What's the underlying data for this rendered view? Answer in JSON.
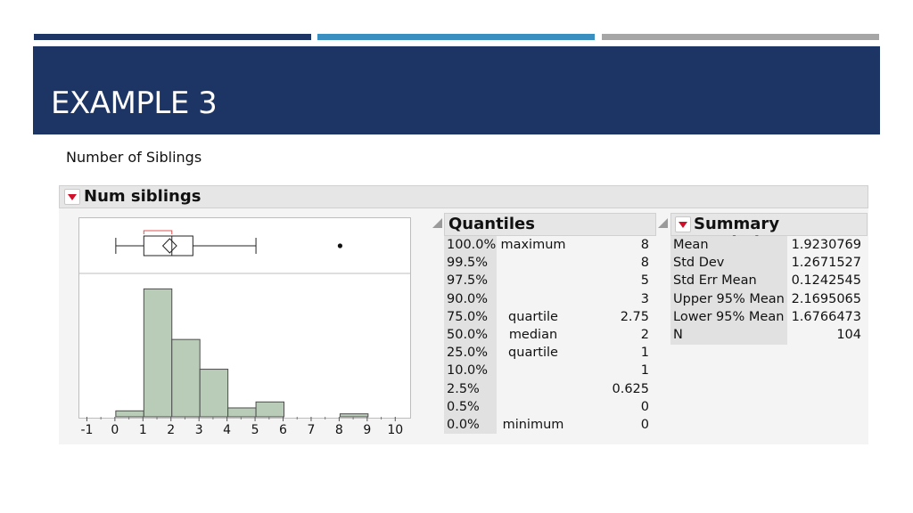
{
  "slide": {
    "title": "EXAMPLE 3",
    "subtitle": "Number of Siblings",
    "bar_colors": [
      "#1c3564",
      "#3a8fc1",
      "#a6a6a6"
    ]
  },
  "report": {
    "title": "Num siblings",
    "quantiles": {
      "title": "Quantiles",
      "rows": [
        {
          "pct": "100.0%",
          "label": "maximum",
          "value": "8"
        },
        {
          "pct": "99.5%",
          "label": "",
          "value": "8"
        },
        {
          "pct": "97.5%",
          "label": "",
          "value": "5"
        },
        {
          "pct": "90.0%",
          "label": "",
          "value": "3"
        },
        {
          "pct": "75.0%",
          "label": "quartile",
          "value": "2.75"
        },
        {
          "pct": "50.0%",
          "label": "median",
          "value": "2"
        },
        {
          "pct": "25.0%",
          "label": "quartile",
          "value": "1"
        },
        {
          "pct": "10.0%",
          "label": "",
          "value": "1"
        },
        {
          "pct": "2.5%",
          "label": "",
          "value": "0.625"
        },
        {
          "pct": "0.5%",
          "label": "",
          "value": "0"
        },
        {
          "pct": "0.0%",
          "label": "minimum",
          "value": "0"
        }
      ]
    },
    "summary": {
      "title": "Summary Statistics",
      "rows": [
        {
          "label": "Mean",
          "value": "1.9230769"
        },
        {
          "label": "Std Dev",
          "value": "1.2671527"
        },
        {
          "label": "Std Err Mean",
          "value": "0.1242545"
        },
        {
          "label": "Upper 95% Mean",
          "value": "2.1695065"
        },
        {
          "label": "Lower 95% Mean",
          "value": "1.6766473"
        },
        {
          "label": "N",
          "value": "104"
        }
      ]
    }
  },
  "chart_data": {
    "type": "bar",
    "title": "",
    "xlabel": "",
    "ylabel": "",
    "bins": [
      [
        0,
        1
      ],
      [
        1,
        2
      ],
      [
        2,
        3
      ],
      [
        3,
        4
      ],
      [
        4,
        5
      ],
      [
        5,
        6
      ],
      [
        6,
        7
      ],
      [
        7,
        8
      ],
      [
        8,
        9
      ]
    ],
    "values": [
      2,
      43,
      26,
      16,
      3,
      5,
      0,
      0,
      1
    ],
    "x_ticks": [
      "-1",
      "0",
      "1",
      "2",
      "3",
      "4",
      "5",
      "6",
      "7",
      "8",
      "9",
      "10"
    ],
    "xlim": [
      -1.3,
      10.5
    ],
    "ylim": [
      0,
      47
    ],
    "boxplot": {
      "min": 0,
      "q1": 1,
      "median": 2,
      "q3": 2.75,
      "max": 5,
      "mean": 1.9230769,
      "lower_95_mean": 1.6766473,
      "upper_95_mean": 2.1695065,
      "shortest_half": [
        1,
        2
      ],
      "outliers": [
        8
      ]
    },
    "bar_color": "#b8ccb8",
    "grid": false
  }
}
